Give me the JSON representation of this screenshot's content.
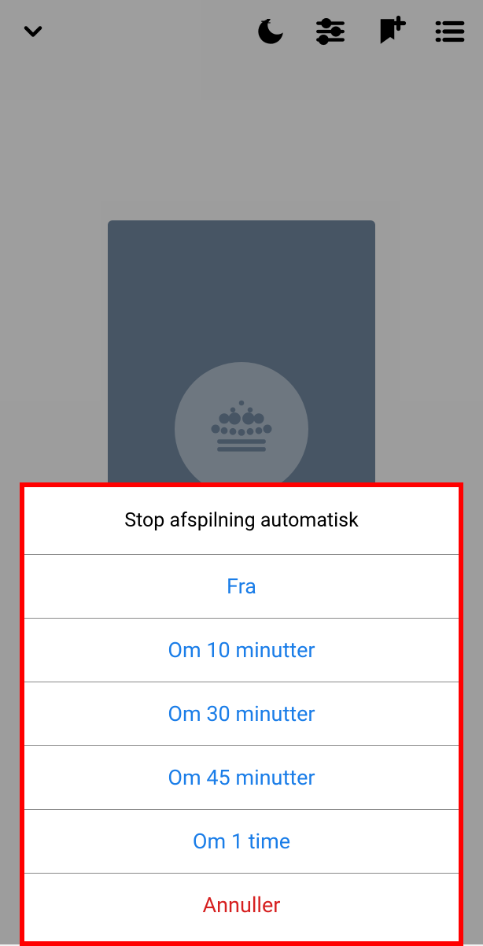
{
  "sheet": {
    "title": "Stop afspilning automatisk",
    "options": [
      "Fra",
      "Om 10 minutter",
      "Om 30 minutter",
      "Om 45 minutter",
      "Om 1 time"
    ],
    "cancel": "Annuller"
  },
  "icons": {
    "collapse": "chevron-down",
    "sleep": "sleep-timer",
    "settings": "sliders",
    "bookmark": "bookmark-add",
    "contents": "list"
  }
}
